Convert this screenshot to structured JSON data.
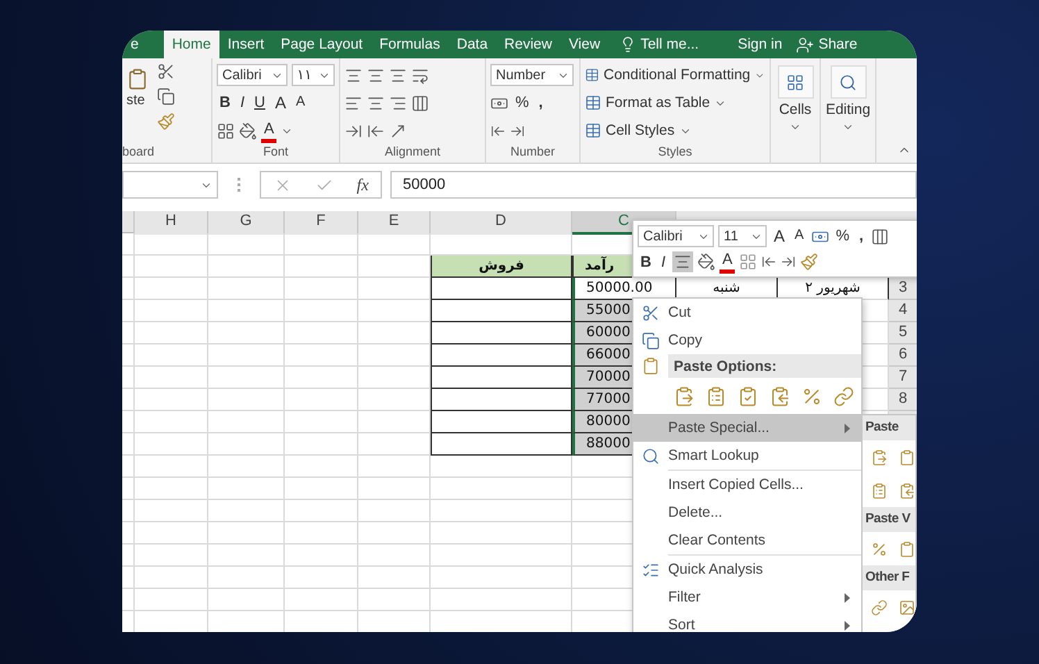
{
  "ribbon": {
    "tabs": [
      {
        "label": "e",
        "selected": false
      },
      {
        "label": "Home",
        "selected": true
      },
      {
        "label": "Insert",
        "selected": false
      },
      {
        "label": "Page Layout",
        "selected": false
      },
      {
        "label": "Formulas",
        "selected": false
      },
      {
        "label": "Data",
        "selected": false
      },
      {
        "label": "Review",
        "selected": false
      },
      {
        "label": "View",
        "selected": false
      }
    ],
    "tell_me": "Tell me...",
    "sign_in": "Sign in",
    "share": "Share",
    "clipboard": {
      "paste_label": "ste",
      "label": "board"
    },
    "font": {
      "name": "Calibri",
      "size": "۱۱",
      "bold": "B",
      "italic": "I",
      "underline": "U",
      "grow": "A",
      "shrink": "A",
      "color_letter": "A",
      "label": "Font"
    },
    "alignment": {
      "label": "Alignment"
    },
    "number": {
      "format": "Number",
      "percent": "%",
      "comma": ",",
      "label": "Number"
    },
    "styles": {
      "items": [
        "Conditional Formatting",
        "Format as Table",
        "Cell Styles"
      ],
      "label": "Styles"
    },
    "cells": {
      "label": "Cells"
    },
    "editing": {
      "label": "Editing"
    }
  },
  "formula_bar": {
    "fx": "fx",
    "value": "50000"
  },
  "sheet": {
    "columns": [
      {
        "label": "H",
        "selected": false
      },
      {
        "label": "G",
        "selected": false
      },
      {
        "label": "F",
        "selected": false
      },
      {
        "label": "E",
        "selected": false
      },
      {
        "label": "D",
        "selected": false
      },
      {
        "label": "C",
        "selected": true
      }
    ],
    "rows": [
      {
        "cells": [
          "",
          "",
          "",
          "",
          {
            "kind": "header",
            "text": "فروش",
            "selected": false
          },
          {
            "kind": "header",
            "text": "رآمد",
            "selected": false
          }
        ]
      },
      {
        "number": "3",
        "cells": [
          "",
          "",
          "",
          "",
          {
            "kind": "value",
            "selected": false
          },
          {
            "kind": "value",
            "text": "50000.00",
            "selected": false
          },
          {
            "kind": "value",
            "text": "شنبه",
            "selected": false
          },
          {
            "kind": "value",
            "text": "۲ شهریور",
            "selected": false
          }
        ]
      },
      {
        "number": "4",
        "cells": [
          "",
          "",
          "",
          "",
          {
            "kind": "value",
            "selected": false
          },
          {
            "kind": "value",
            "text": "55000",
            "selected": true
          }
        ]
      },
      {
        "number": "5",
        "cells": [
          "",
          "",
          "",
          "",
          {
            "kind": "value",
            "selected": false
          },
          {
            "kind": "value",
            "text": "60000",
            "selected": true
          }
        ]
      },
      {
        "number": "6",
        "cells": [
          "",
          "",
          "",
          "",
          {
            "kind": "value",
            "selected": false
          },
          {
            "kind": "value",
            "text": "66000",
            "selected": true
          }
        ]
      },
      {
        "number": "7",
        "cells": [
          "",
          "",
          "",
          "",
          {
            "kind": "value",
            "selected": false
          },
          {
            "kind": "value",
            "text": "70000",
            "selected": true
          }
        ]
      },
      {
        "number": "8",
        "cells": [
          "",
          "",
          "",
          "",
          {
            "kind": "value",
            "selected": false
          },
          {
            "kind": "value",
            "text": "77000",
            "selected": true
          }
        ]
      },
      {
        "cells": [
          "",
          "",
          "",
          "",
          {
            "kind": "value",
            "selected": false
          },
          {
            "kind": "value",
            "text": "80000",
            "selected": true
          }
        ]
      },
      {
        "cells": [
          "",
          "",
          "",
          "",
          {
            "kind": "value",
            "selected": false
          },
          {
            "kind": "value",
            "text": "88000",
            "selected": true
          }
        ]
      }
    ]
  },
  "mini_toolbar": {
    "font": "Calibri",
    "size": "11",
    "grow": "A",
    "shrink": "A",
    "percent": "%",
    "comma": ",",
    "bold": "B",
    "italic": "I",
    "color_letter": "A"
  },
  "context_menu": {
    "items": [
      {
        "kind": "item",
        "label": "Cut",
        "selected": false
      },
      {
        "kind": "item",
        "label": "Copy",
        "selected": false
      },
      {
        "kind": "header",
        "label": "Paste Options:"
      },
      {
        "kind": "paste_icons"
      },
      {
        "kind": "item",
        "label": "Paste Special...",
        "selected": true,
        "submenu": true
      },
      {
        "kind": "item",
        "label": "Smart Lookup",
        "selected": false
      },
      {
        "kind": "separator"
      },
      {
        "kind": "item",
        "label": "Insert Copied Cells...",
        "selected": false
      },
      {
        "kind": "item",
        "label": "Delete...",
        "selected": false
      },
      {
        "kind": "item",
        "label": "Clear Contents",
        "selected": false
      },
      {
        "kind": "separator"
      },
      {
        "kind": "item",
        "label": "Quick Analysis",
        "selected": false
      },
      {
        "kind": "item",
        "label": "Filter",
        "selected": false,
        "submenu": true
      },
      {
        "kind": "item",
        "label": "Sort",
        "selected": false,
        "submenu": true
      }
    ]
  },
  "paste_submenu": {
    "sections": [
      {
        "header": "Paste"
      },
      {
        "header": "Paste V"
      },
      {
        "header": "Other F"
      }
    ]
  }
}
